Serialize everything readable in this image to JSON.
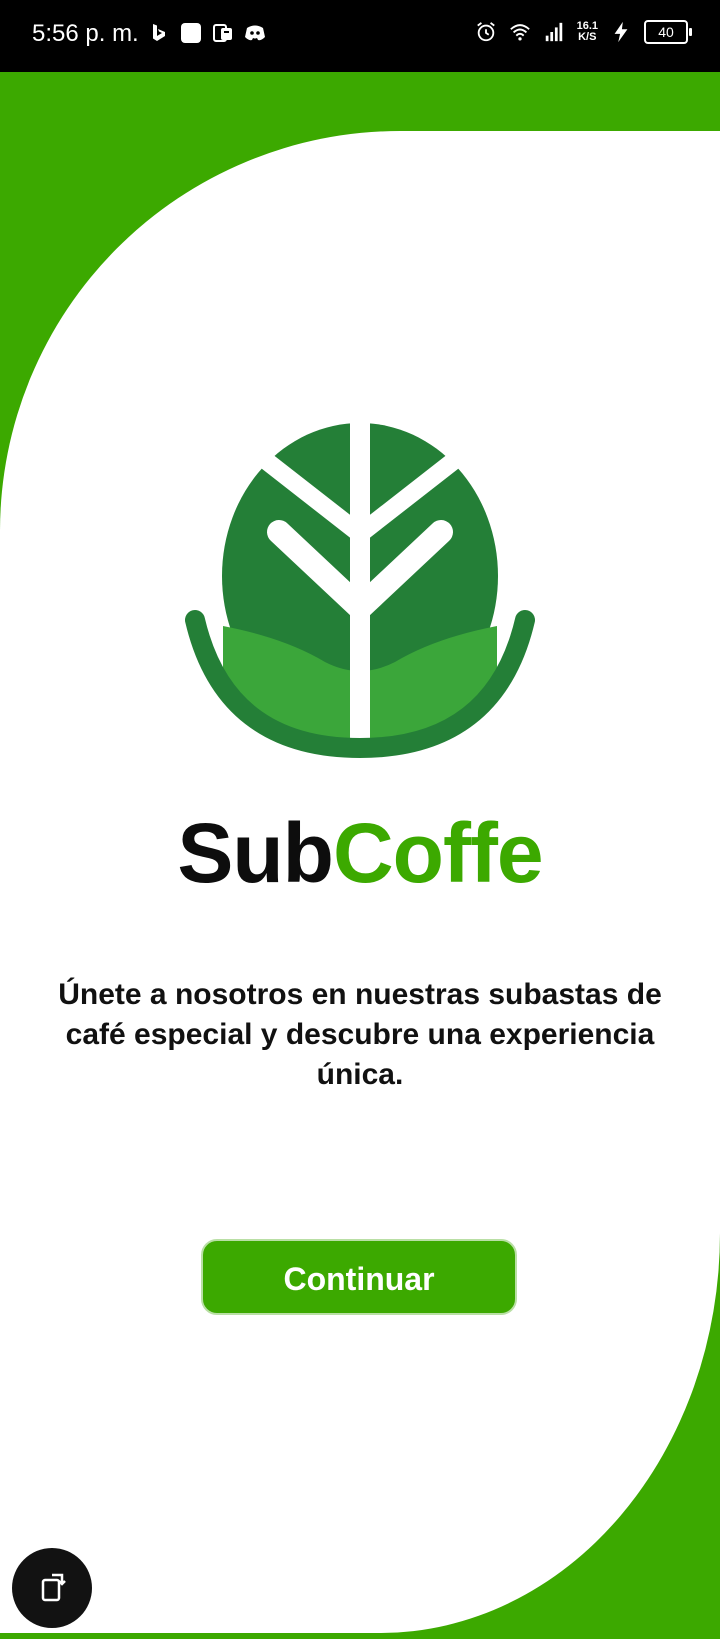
{
  "status_bar": {
    "time": "5:56 p. m.",
    "network_speed_value": "16.1",
    "network_speed_unit": "K/S",
    "battery": "40",
    "left_icons": [
      "bing-icon",
      "square-app-icon",
      "document-app-icon",
      "discord-icon"
    ],
    "right_icons": [
      "alarm-icon",
      "wifi-icon",
      "signal-icon",
      "charging-icon",
      "battery-icon"
    ]
  },
  "app": {
    "brand_part1": "Sub",
    "brand_part2": "Coffe",
    "tagline": "Únete a nosotros en nuestras subastas de café especial y descubre una experiencia única.",
    "continue_label": "Continuar"
  },
  "colors": {
    "brand_green": "#3ca900",
    "logo_dark_green": "#247f37",
    "logo_light_green": "#3ba63a",
    "card_bg": "#ffffff"
  },
  "floating": {
    "rotate_button_icon": "screen-rotate-icon"
  }
}
